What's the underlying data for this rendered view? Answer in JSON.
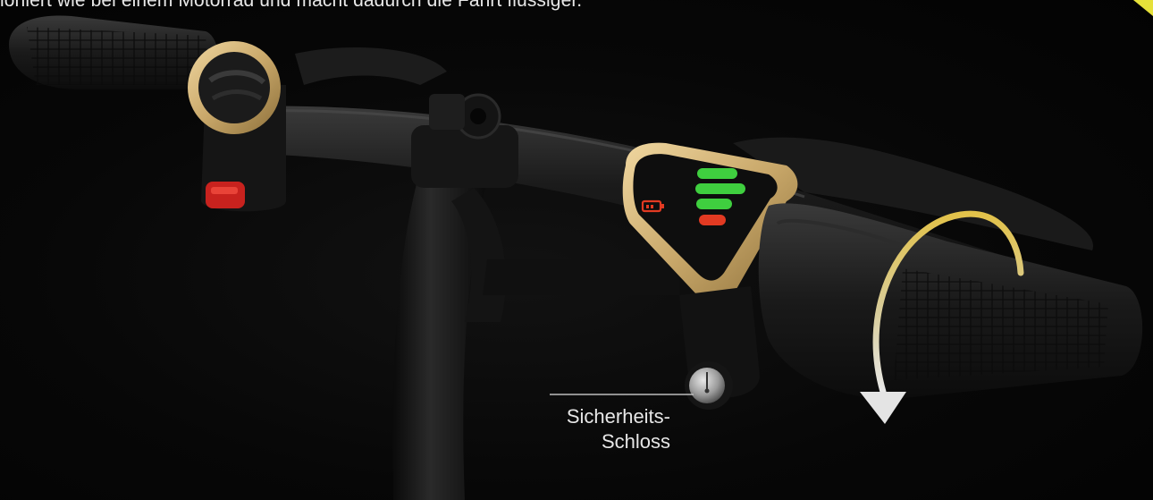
{
  "intro_text": "ioniert wie bei einem Motorrad und macht dadurch die Fahrt flüssiger.",
  "lock_label": {
    "line1": "Sicherheits-",
    "line2": "Schloss"
  },
  "colors": {
    "gold_trim": "#c9a86a",
    "battery_bar_green": "#3fcf3f",
    "battery_bar_red": "#e23a22",
    "corner_accent": "#e6e13a",
    "arrow_gradient_start": "#e2c24a",
    "arrow_gradient_end": "#e8e8e8"
  },
  "icons": {
    "battery": "battery-icon",
    "rotation": "curved-arrow-icon",
    "lock": "key-lock-icon",
    "horn": "horn-button-icon"
  },
  "battery_display": {
    "green_bars": 3,
    "red_bars": 1
  }
}
